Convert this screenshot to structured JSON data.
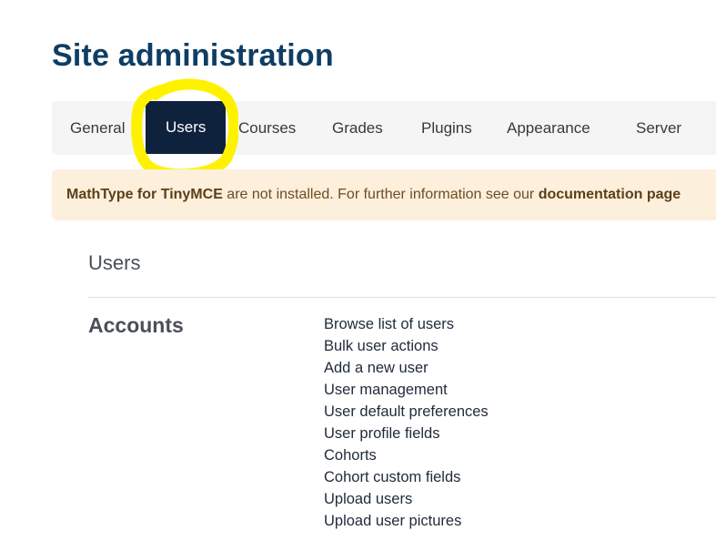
{
  "page": {
    "title": "Site administration"
  },
  "tabs": [
    {
      "label": "General"
    },
    {
      "label": "Users",
      "active": true
    },
    {
      "label": "Courses"
    },
    {
      "label": "Grades"
    },
    {
      "label": "Plugins"
    },
    {
      "label": "Appearance"
    },
    {
      "label": "Server"
    }
  ],
  "annotation": {
    "color": "#fff200",
    "shape": "hand-drawn circle around active tab"
  },
  "notice": {
    "product": "MathType for TinyMCE",
    "text": " are not installed. For further information see our ",
    "link": "documentation page"
  },
  "section": {
    "title": "Users"
  },
  "category": {
    "title": "Accounts",
    "links": [
      "Browse list of users",
      "Bulk user actions",
      "Add a new user",
      "User management",
      "User default preferences",
      "User profile fields",
      "Cohorts",
      "Cohort custom fields",
      "Upload users",
      "Upload user pictures"
    ]
  },
  "colors": {
    "title": "#0f3d63",
    "active_tab_bg": "#0e223d",
    "tabbar_bg": "#f5f5f5",
    "notice_bg": "#fcefdc"
  }
}
